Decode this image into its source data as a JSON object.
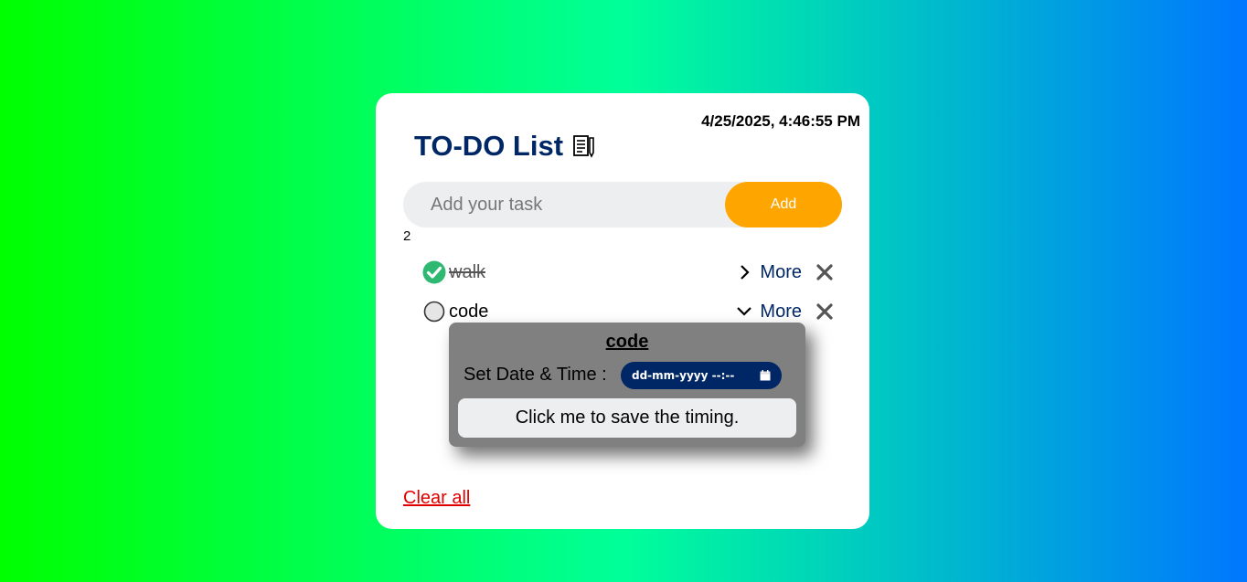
{
  "header": {
    "datetime": "4/25/2025, 4:46:55 PM",
    "title": "TO-DO List",
    "title_icon": "memo-icon"
  },
  "input": {
    "placeholder": "Add your task",
    "value": "",
    "add_label": "Add"
  },
  "task_count": "2",
  "tasks": [
    {
      "name": "walk",
      "completed": true,
      "more_label": "More",
      "expanded": false
    },
    {
      "name": "code",
      "completed": false,
      "more_label": "More",
      "expanded": true
    }
  ],
  "popup": {
    "title": "code",
    "date_label": "Set Date & Time :",
    "date_placeholder": "dd-mm-yyyy --:--",
    "save_label": "Click me to save the timing."
  },
  "clear_all_label": "Clear all",
  "colors": {
    "accent": "#ffa500",
    "brand": "#002765",
    "check": "#2eb872",
    "clear": "#e00000"
  }
}
